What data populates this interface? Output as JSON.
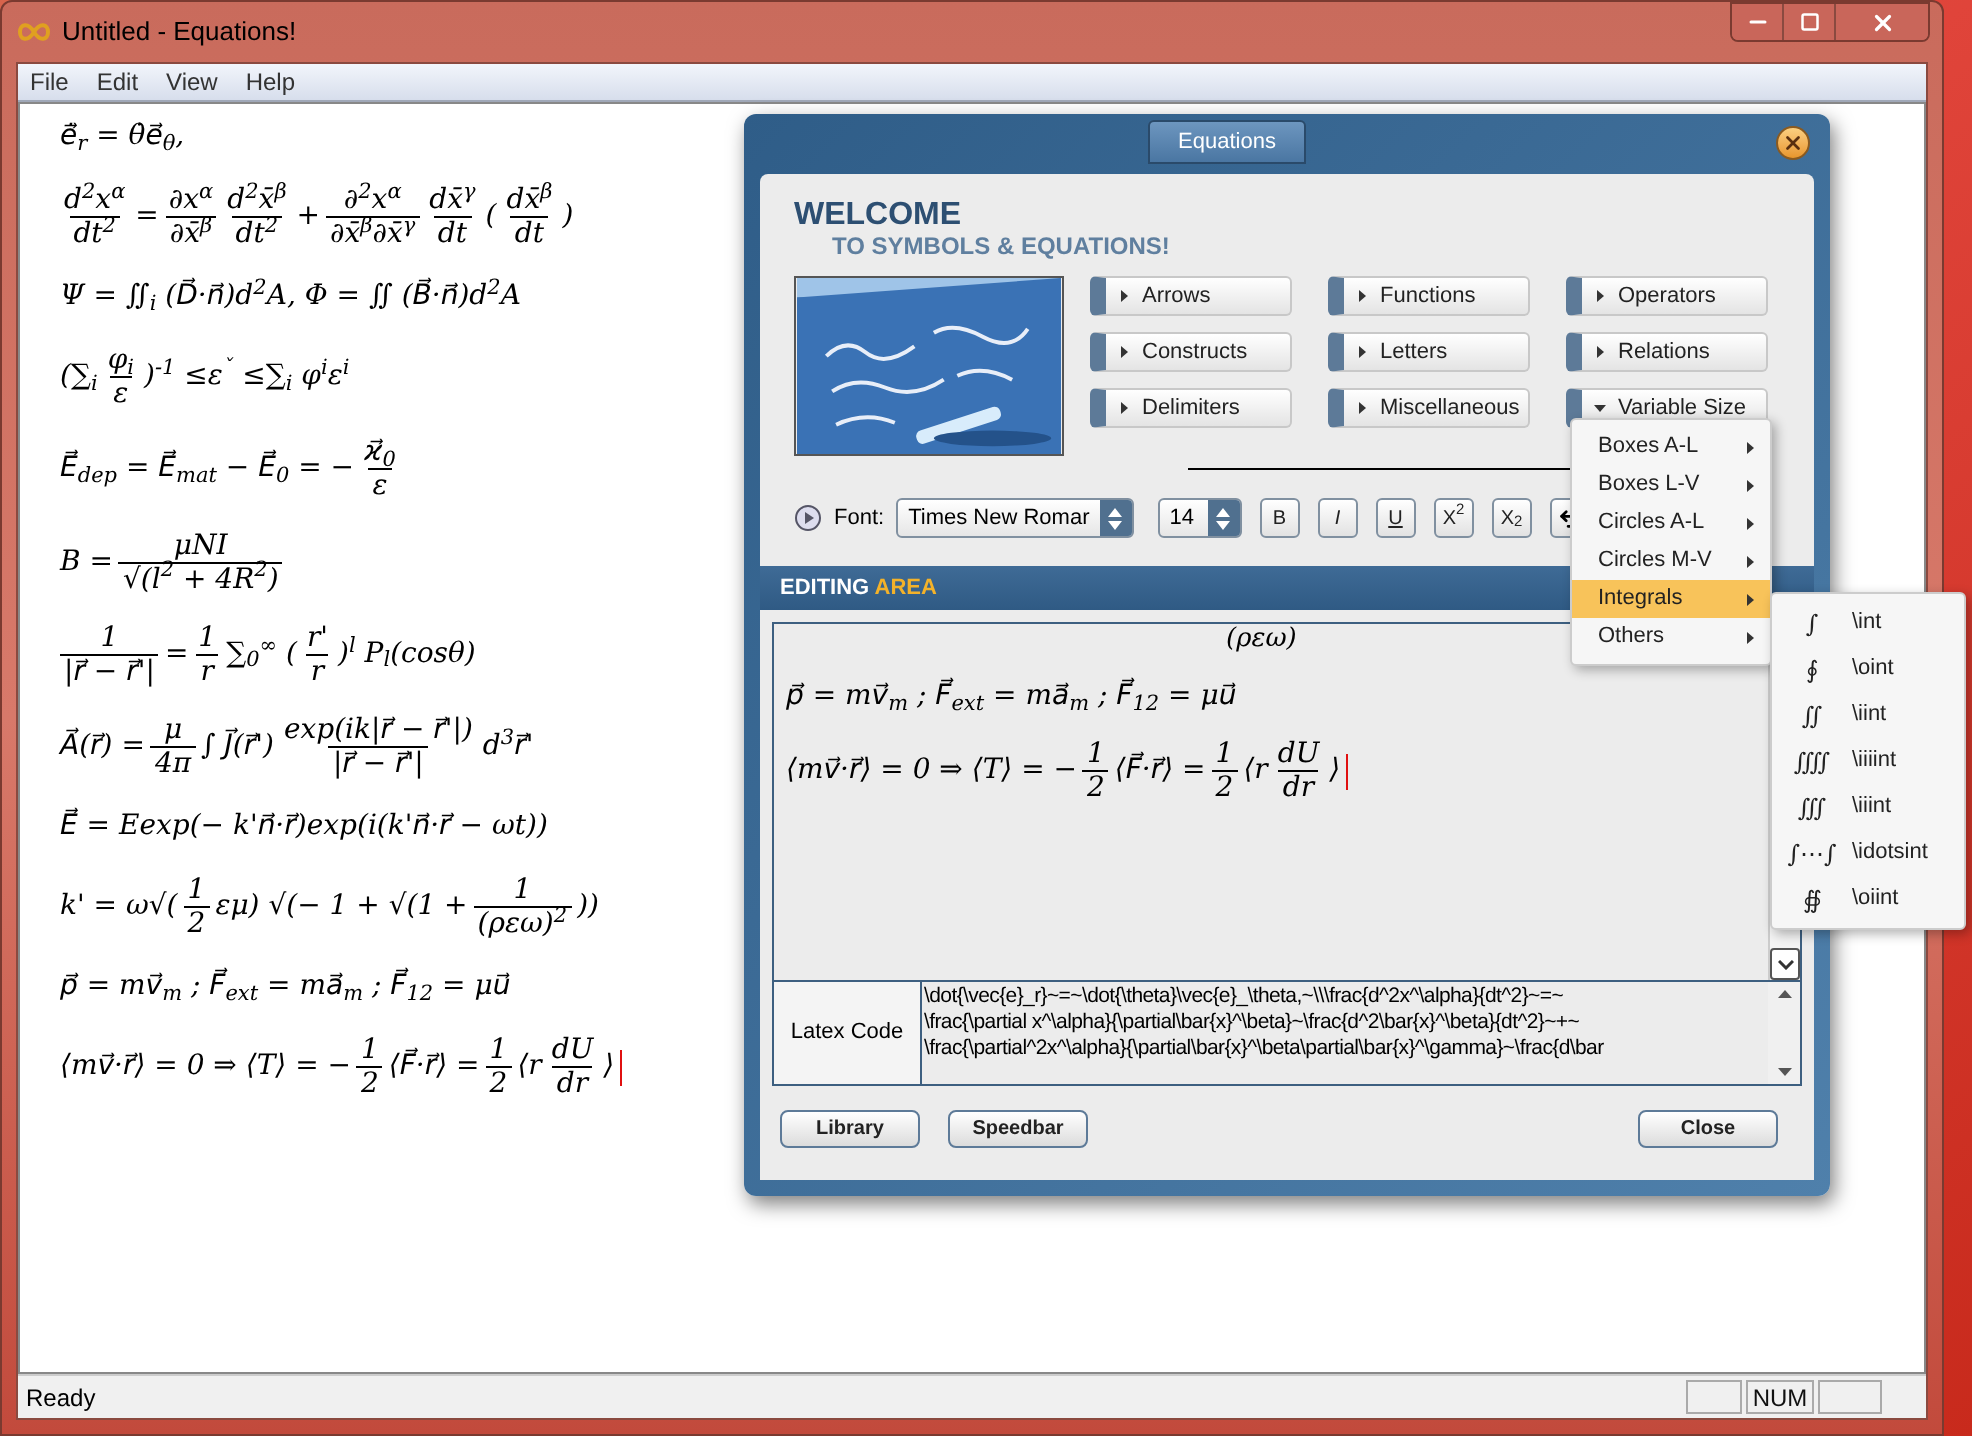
{
  "window": {
    "title": "Untitled - Equations!"
  },
  "menu": [
    "File",
    "Edit",
    "View",
    "Help"
  ],
  "equations": [
    [
      {
        "kind": "text",
        "text": "e⃗̇$_{r}$ = θ̇e⃗$_{θ}$,"
      }
    ],
    [
      {
        "kind": "frac",
        "num": "d$^{2}$x$^{α}$",
        "den": "dt$^{2}$"
      },
      {
        "kind": "text",
        "text": "="
      },
      {
        "kind": "frac",
        "num": "∂x$^{α}$",
        "den": "∂x̄$^{β}$"
      },
      {
        "kind": "frac",
        "num": "d$^{2}$x̄$^{β}$",
        "den": "dt$^{2}$"
      },
      {
        "kind": "text",
        "text": "+"
      },
      {
        "kind": "frac",
        "num": "∂$^{2}$x$^{α}$",
        "den": "∂x̄$^{β}$∂x̄$^{γ}$"
      },
      {
        "kind": "frac",
        "num": "dx̄$^{γ}$",
        "den": "dt"
      },
      {
        "kind": "text",
        "text": "("
      },
      {
        "kind": "frac",
        "num": "dx̄$^{β}$",
        "den": "dt"
      },
      {
        "kind": "text",
        "text": ")"
      }
    ],
    [
      {
        "kind": "text",
        "text": "Ψ = ∬$_{i}$ (D⃗·n⃗)d$^{2}$A,   Φ = ∬ (B⃗·n⃗)d$^{2}$A"
      }
    ],
    [
      {
        "kind": "text",
        "text": "(∑$_{i}$"
      },
      {
        "kind": "frac",
        "num": "φ$_{i}$",
        "den": "ε"
      },
      {
        "kind": "text",
        "text": ")$^{-1}$ ≤ε$^{ˇ}$ ≤∑$_{i}$ φ$^{i}$ε$^{i}$"
      }
    ],
    [
      {
        "kind": "text",
        "text": "E⃗$_{dep}$ = E⃗$_{mat}$ − E⃗$_{0}$ = −"
      },
      {
        "kind": "frac",
        "num": "ϰ⃗$_{0}$",
        "den": "ε"
      }
    ],
    [
      {
        "kind": "text",
        "text": "B ="
      },
      {
        "kind": "frac",
        "num": "μNI",
        "den": "√(l$^{2}$ + 4R$^{2}$)"
      }
    ],
    [
      {
        "kind": "frac",
        "num": "1",
        "den": "|r⃗ − r⃗'|"
      },
      {
        "kind": "text",
        "text": "="
      },
      {
        "kind": "frac",
        "num": "1",
        "den": "r"
      },
      {
        "kind": "text",
        "text": "∑$_{0}$$^{∞}$ ("
      },
      {
        "kind": "frac",
        "num": "r'",
        "den": "r"
      },
      {
        "kind": "text",
        "text": ")$^{l}$ P$_{l}$(cosθ)"
      }
    ],
    [
      {
        "kind": "text",
        "text": "A⃗(r⃗) ="
      },
      {
        "kind": "frac",
        "num": "μ",
        "den": "4π"
      },
      {
        "kind": "text",
        "text": "∫ J⃗(r⃗')"
      },
      {
        "kind": "frac",
        "num": "exp(ik|r⃗ − r⃗'|)",
        "den": "|r⃗ − r⃗'|"
      },
      {
        "kind": "text",
        "text": "d$^{3}$r⃗'"
      }
    ],
    [
      {
        "kind": "text",
        "text": "E⃗ = Eexp(− k'n⃗·r⃗)exp(i(k'n⃗·r⃗ − ωt))"
      }
    ],
    [
      {
        "kind": "text",
        "text": "k' = ω√("
      },
      {
        "kind": "frac",
        "num": "1",
        "den": "2"
      },
      {
        "kind": "text",
        "text": "εμ) √(− 1 + √(1 +"
      },
      {
        "kind": "frac",
        "num": "1",
        "den": "(ρεω)$^{2}$"
      },
      {
        "kind": "text",
        "text": "))"
      }
    ],
    [
      {
        "kind": "text",
        "text": "p⃗ = mv⃗$_{m}$ ;  F⃗$_{ext}$ = ma⃗$_{m}$ ;  F⃗$_{12}$ = μu⃗"
      }
    ],
    [
      {
        "kind": "text",
        "text": "⟨mv⃗·r⃗⟩ = 0 ⇒ ⟨T⟩ = −"
      },
      {
        "kind": "frac",
        "num": "1",
        "den": "2"
      },
      {
        "kind": "text",
        "text": "⟨F⃗·r⃗⟩ ="
      },
      {
        "kind": "frac",
        "num": "1",
        "den": "2"
      },
      {
        "kind": "text",
        "text": "⟨r"
      },
      {
        "kind": "frac",
        "num": "dU",
        "den": "dr"
      },
      {
        "kind": "text",
        "text": "⟩"
      }
    ]
  ],
  "status_bar": {
    "text": "Ready",
    "indicator": "NUM"
  },
  "dialog": {
    "tab": "Equations",
    "welcome": "WELCOME",
    "subtitle": "TO SYMBOLS & EQUATIONS!",
    "categories": [
      {
        "label": "Arrows",
        "expanded": false
      },
      {
        "label": "Functions",
        "expanded": false
      },
      {
        "label": "Operators",
        "expanded": false
      },
      {
        "label": "Constructs",
        "expanded": false
      },
      {
        "label": "Letters",
        "expanded": false
      },
      {
        "label": "Relations",
        "expanded": false
      },
      {
        "label": "Delimiters",
        "expanded": false
      },
      {
        "label": "Miscellaneous",
        "expanded": false
      },
      {
        "label": "Variable Size",
        "expanded": true
      }
    ],
    "font_label": "Font:",
    "font": "Times New Romar",
    "size": "14",
    "format_buttons": [
      "B",
      "I",
      "U",
      "X$^{2}$",
      "X$_{2}$"
    ],
    "editing_title": "EDITING",
    "editing_accent": "AREA",
    "editor_partial": "(ρεω)",
    "editor_equations": [
      [
        {
          "kind": "text",
          "text": "p⃗ = mv⃗$_{m}$ ;  F⃗$_{ext}$ = ma⃗$_{m}$ ;  F⃗$_{12}$ = μu⃗"
        }
      ],
      [
        {
          "kind": "text",
          "text": "⟨mv⃗·r⃗⟩ = 0 ⇒ ⟨T⟩ = −"
        },
        {
          "kind": "frac",
          "num": "1",
          "den": "2"
        },
        {
          "kind": "text",
          "text": "⟨F⃗·r⃗⟩ ="
        },
        {
          "kind": "frac",
          "num": "1",
          "den": "2"
        },
        {
          "kind": "text",
          "text": "⟨r"
        },
        {
          "kind": "frac",
          "num": "dU",
          "den": "dr"
        },
        {
          "kind": "text",
          "text": "⟩"
        }
      ]
    ],
    "latex_label": "Latex Code",
    "latex_lines": [
      "\\dot{\\vec{e}_r}~=~\\dot{\\theta}\\vec{e}_\\theta,~\\\\\\frac{d^2x^\\alpha}{dt^2}~=~",
      "\\frac{\\partial x^\\alpha}{\\partial\\bar{x}^\\beta}~\\frac{d^2\\bar{x}^\\beta}{dt^2}~+~",
      "\\frac{\\partial^2x^\\alpha}{\\partial\\bar{x}^\\beta\\partial\\bar{x}^\\gamma}~\\frac{d\\bar"
    ],
    "buttons": [
      "Library",
      "Speedbar"
    ],
    "close": "Close"
  },
  "popup_menu": [
    {
      "label": "Boxes A-L",
      "selected": false
    },
    {
      "label": "Boxes L-V",
      "selected": false
    },
    {
      "label": "Circles A-L",
      "selected": false
    },
    {
      "label": "Circles M-V",
      "selected": false
    },
    {
      "label": "Integrals",
      "selected": true
    },
    {
      "label": "Others",
      "selected": false
    }
  ],
  "submenu": [
    {
      "symbol": "∫",
      "command": "\\int"
    },
    {
      "symbol": "∮",
      "command": "\\oint"
    },
    {
      "symbol": "∬",
      "command": "\\iint"
    },
    {
      "symbol": "⨌",
      "command": "\\iiiint"
    },
    {
      "symbol": "∭",
      "command": "\\iiint"
    },
    {
      "symbol": "∫⋯∫",
      "command": "\\idotsint"
    },
    {
      "symbol": "∯",
      "command": "\\oiint"
    }
  ]
}
